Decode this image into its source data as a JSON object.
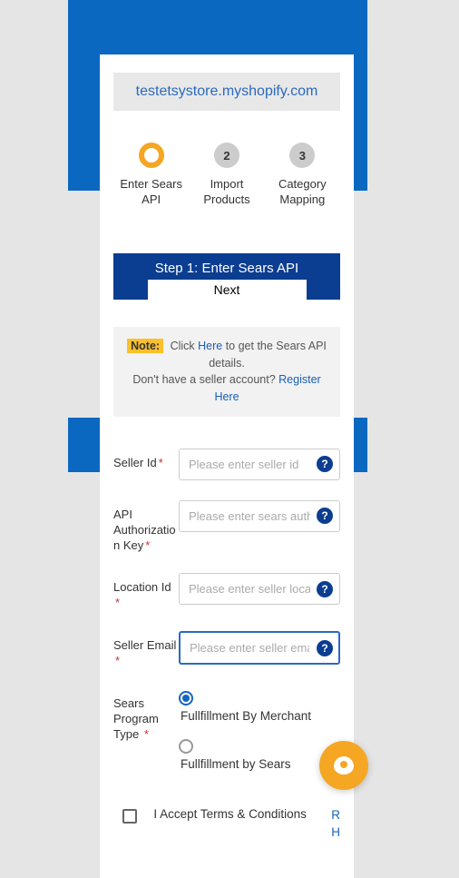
{
  "storeUrl": "testetsystore.myshopify.com",
  "steps": [
    {
      "num": "",
      "label": "Enter Sears API",
      "active": true
    },
    {
      "num": "2",
      "label": "Import Products",
      "active": false
    },
    {
      "num": "3",
      "label": "Category Mapping",
      "active": false
    }
  ],
  "stepHeader": {
    "title": "Step 1: Enter Sears API",
    "next": "Next"
  },
  "note": {
    "label": "Note:",
    "text1": "Click ",
    "link1": "Here",
    "text2": " to get the Sears API details.",
    "text3": "Don't have a seller account? ",
    "link2": "Register Here"
  },
  "fields": {
    "sellerId": {
      "label": "Seller Id",
      "placeholder": "Please enter seller id"
    },
    "authKey": {
      "label": "API Authorization Key",
      "placeholder": "Please enter sears auth key"
    },
    "locationId": {
      "label": "Location Id",
      "placeholder": "Please enter seller location id"
    },
    "sellerEmail": {
      "label": "Seller Email",
      "placeholder": "Please enter seller email"
    },
    "programType": {
      "label": "Sears Program Type",
      "option1": "Fullfillment By Merchant",
      "option2": "Fullfillment by Sears"
    }
  },
  "terms": {
    "text": "I Accept Terms & Conditions",
    "link": "R H"
  }
}
